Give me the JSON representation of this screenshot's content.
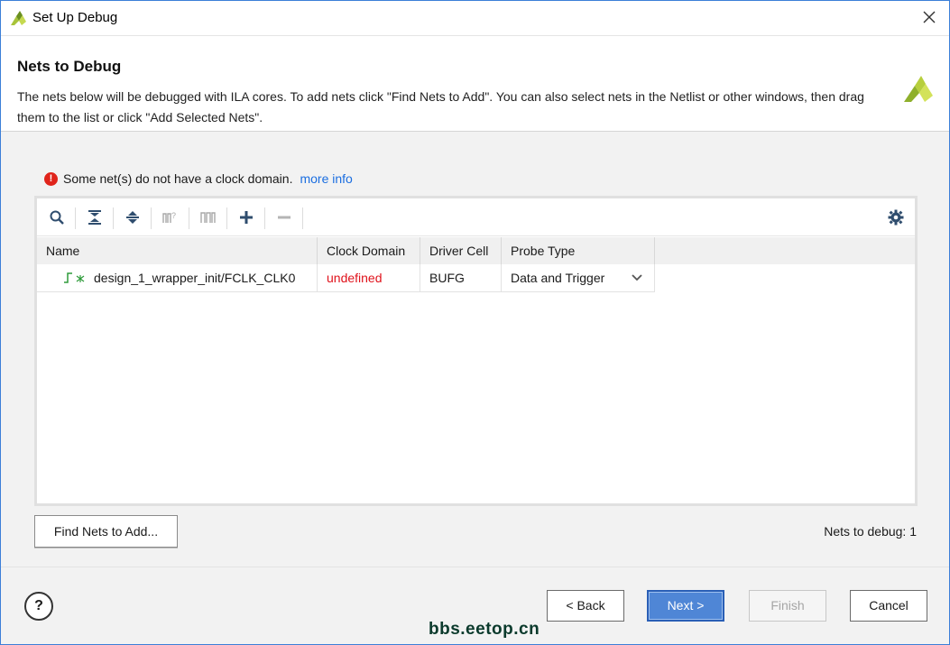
{
  "window": {
    "title": "Set Up Debug",
    "close_icon": "close-icon",
    "app_icon": "xilinx-logo-icon"
  },
  "header": {
    "title": "Nets to Debug",
    "description": "The nets below will be debugged with ILA cores. To add nets click \"Find Nets to Add\". You can also select nets in the Netlist or other windows, then drag them to the list or click \"Add Selected Nets\".",
    "logo_icon": "xilinx-logo-icon"
  },
  "warning": {
    "icon": "error-icon",
    "message": "Some net(s) do not have a clock domain.",
    "link": "more info"
  },
  "toolbar": {
    "buttons": [
      {
        "icon": "search-icon",
        "enabled": true
      },
      {
        "icon": "collapse-all-icon",
        "enabled": true
      },
      {
        "icon": "expand-all-icon",
        "enabled": true
      },
      {
        "icon": "probe-type-icon",
        "enabled": false
      },
      {
        "icon": "waveform-icon",
        "enabled": false
      },
      {
        "icon": "plus-icon",
        "enabled": true
      },
      {
        "icon": "minus-icon",
        "enabled": false
      }
    ],
    "settings_icon": "gear-icon"
  },
  "table": {
    "columns": [
      "Name",
      "Clock Domain",
      "Driver Cell",
      "Probe Type"
    ],
    "rows": [
      {
        "name": "design_1_wrapper_init/FCLK_CLK0",
        "clock_domain": "undefined",
        "driver_cell": "BUFG",
        "probe_type": "Data and Trigger"
      }
    ]
  },
  "find_button": "Find Nets to Add...",
  "nets_count": "Nets to debug: 1",
  "footer": {
    "help": "?",
    "back": "< Back",
    "next": "Next >",
    "finish": "Finish",
    "cancel": "Cancel"
  },
  "watermark": "bbs.eetop.cn",
  "colors": {
    "accent": "#4f86d6",
    "error": "#e0241b",
    "link": "#1b6ee0",
    "undefined_text": "#e0121b"
  }
}
